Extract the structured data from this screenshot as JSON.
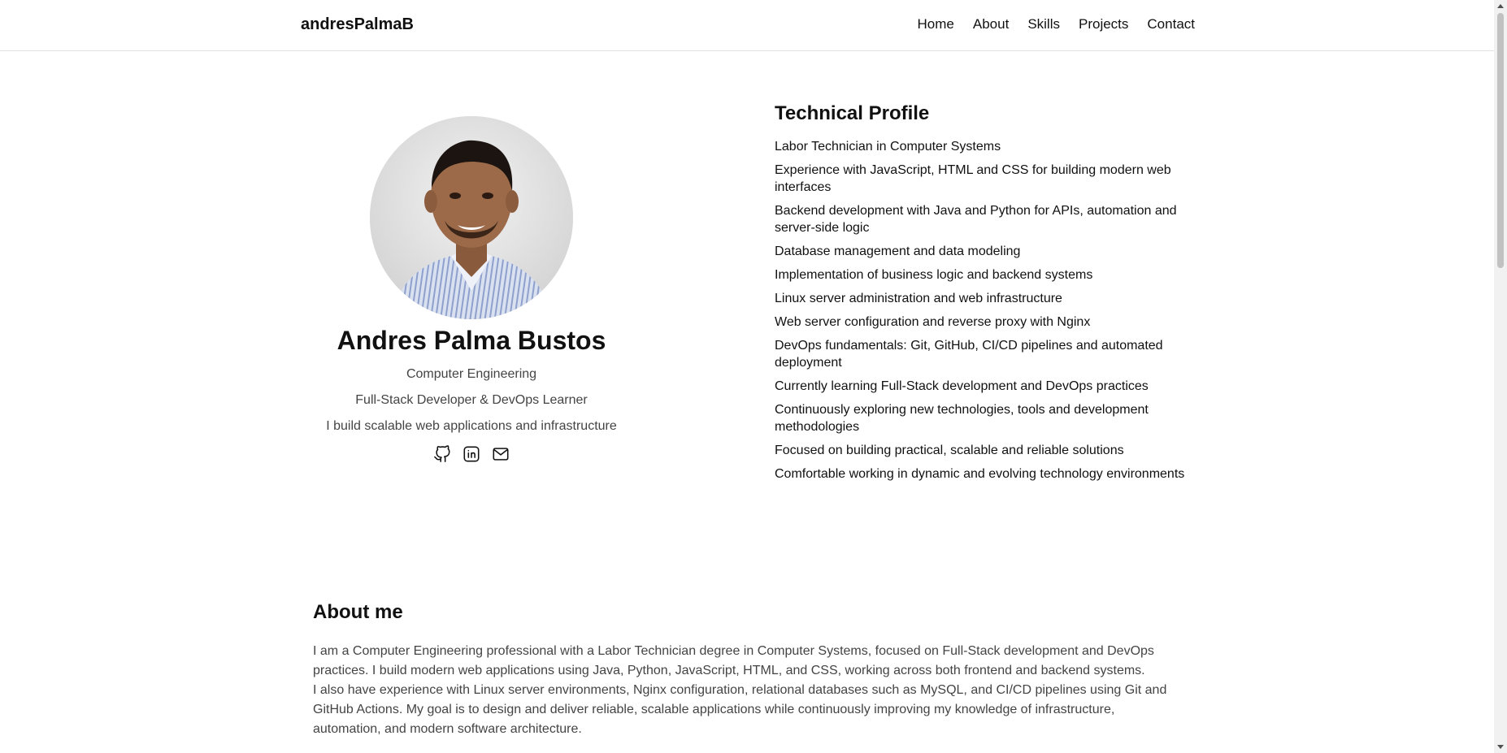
{
  "header": {
    "brand": "andresPalmaB",
    "nav": [
      "Home",
      "About",
      "Skills",
      "Projects",
      "Contact"
    ]
  },
  "profile": {
    "name": "Andres Palma Bustos",
    "degree": "Computer Engineering",
    "role": "Full-Stack Developer & DevOps Learner",
    "tagline": "I build scalable web applications and infrastructure",
    "socials": [
      "github-icon",
      "linkedin-icon",
      "mail-icon"
    ]
  },
  "technical_profile": {
    "title": "Technical Profile",
    "items": [
      "Labor Technician in Computer Systems",
      "Experience with JavaScript, HTML and CSS for building modern web interfaces",
      "Backend development with Java and Python for APIs, automation and server-side logic",
      "Database management and data modeling",
      "Implementation of business logic and backend systems",
      "Linux server administration and web infrastructure",
      "Web server configuration and reverse proxy with Nginx",
      "DevOps fundamentals: Git, GitHub, CI/CD pipelines and automated deployment",
      "Currently learning Full-Stack development and DevOps practices",
      "Continuously exploring new technologies, tools and development methodologies",
      "Focused on building practical, scalable and reliable solutions",
      "Comfortable working in dynamic and evolving technology environments"
    ]
  },
  "about": {
    "title": "About me",
    "paragraphs": [
      "I am a Computer Engineering professional with a Labor Technician degree in Computer Systems, focused on Full-Stack development and DevOps practices. I build modern web applications using Java, Python, JavaScript, HTML, and CSS, working across both frontend and backend systems.",
      "I also have experience with Linux server environments, Nginx configuration, relational databases such as MySQL, and CI/CD pipelines using Git and GitHub Actions. My goal is to design and deliver reliable, scalable applications while continuously improving my knowledge of infrastructure, automation, and modern software architecture."
    ]
  }
}
